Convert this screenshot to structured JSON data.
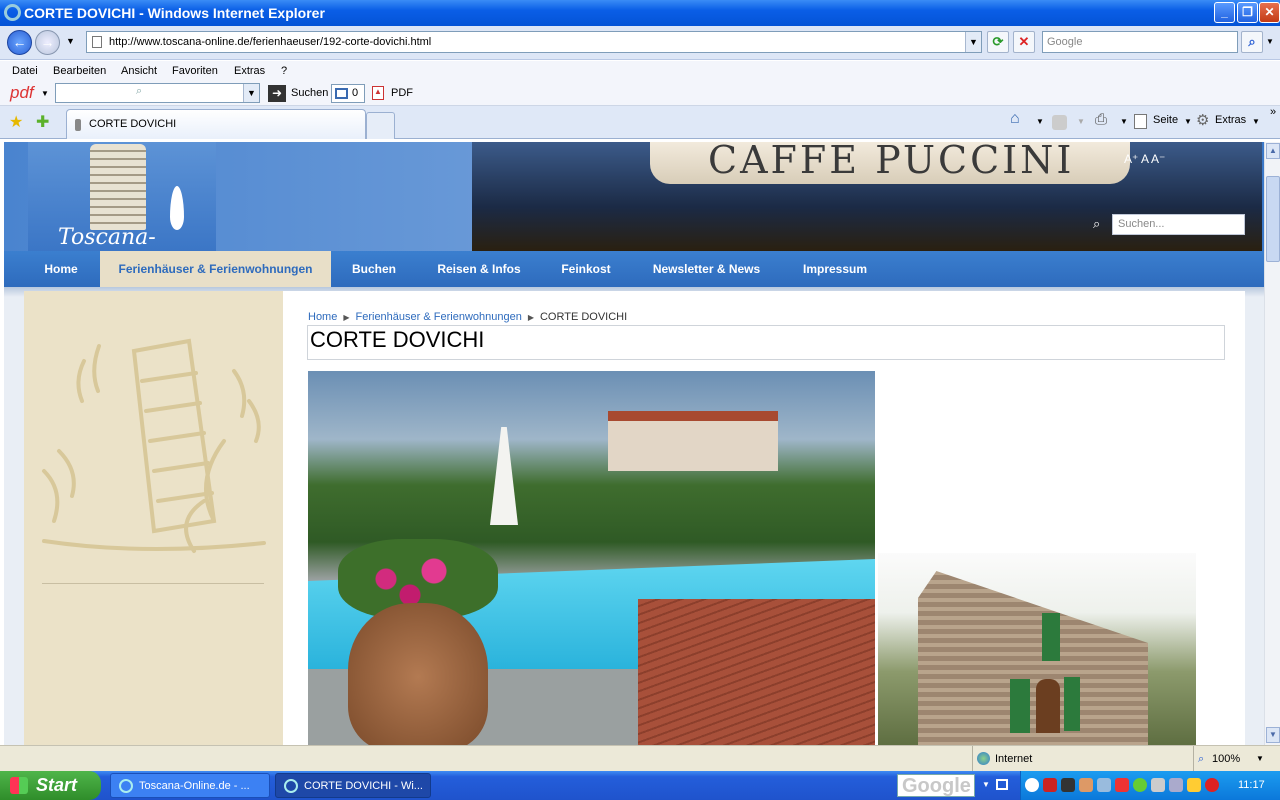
{
  "window": {
    "title": "CORTE DOVICHI - Windows Internet Explorer",
    "minimize_icon": "minimize-icon",
    "maximize_icon": "restore-icon",
    "close_icon": "close-icon"
  },
  "addressbar": {
    "url": "http://www.toscana-online.de/ferienhaeuser/192-corte-dovichi.html",
    "search_placeholder": "Google"
  },
  "menu": {
    "items": [
      "Datei",
      "Bearbeiten",
      "Ansicht",
      "Favoriten",
      "Extras",
      "?"
    ]
  },
  "pdfbar": {
    "logo": "pdf",
    "search_label": "Suchen",
    "counter": "0",
    "pdf_label": "PDF"
  },
  "tabs": {
    "active_label": "CORTE DOVICHI"
  },
  "commandbar": {
    "page_label": "Seite",
    "tools_label": "Extras"
  },
  "site": {
    "logo_text": "Toscana-Online.de",
    "cafe_sign": "CAFFE PUCCINI",
    "font_sizes": "A⁺ A A⁻",
    "search_placeholder": "Suchen...",
    "nav": [
      "Home",
      "Ferienhäuser & Ferienwohnungen",
      "Buchen",
      "Reisen & Infos",
      "Feinkost",
      "Newsletter & News",
      "Impressum"
    ],
    "nav_active_index": 1,
    "breadcrumb": {
      "home": "Home",
      "section": "Ferienhäuser & Ferienwohnungen",
      "current": "CORTE DOVICHI"
    },
    "page_title": "CORTE DOVICHI"
  },
  "statusbar": {
    "zone": "Internet",
    "zoom": "100%"
  },
  "taskbar": {
    "start_label": "Start",
    "task1": "Toscana-Online.de - ...",
    "task2": "CORTE DOVICHI - Wi...",
    "google_label": "Google",
    "clock": "11:17"
  }
}
